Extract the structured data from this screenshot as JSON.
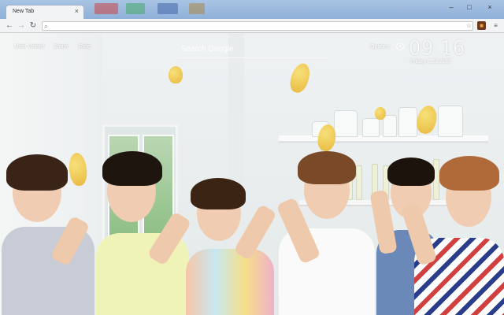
{
  "browser": {
    "tab_title": "New Tab",
    "tab_close_icon": "close-icon",
    "window_controls": [
      "minimize-icon",
      "maximize-icon",
      "close-icon"
    ],
    "back_icon": "back-arrow-icon",
    "forward_icon": "forward-arrow-icon",
    "reload_icon": "reload-icon",
    "url": "",
    "bookmark_icon": "star-icon",
    "menu_icon": "menu-icon"
  },
  "newtab": {
    "links": {
      "most_visited": "Most Visited",
      "share": "Share",
      "rate": "Rate"
    },
    "search": {
      "placeholder": "Search Google"
    },
    "options": "Options",
    "clock": {
      "time": "09:16",
      "date": "Friday 6.23.2017"
    }
  }
}
